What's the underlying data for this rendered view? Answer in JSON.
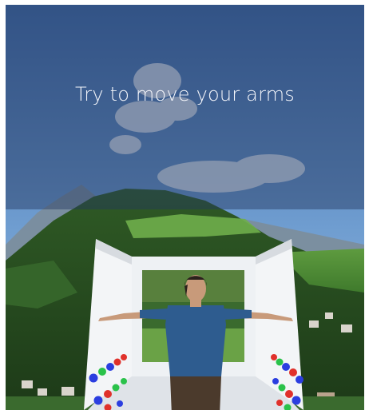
{
  "overlay": {
    "instruction": "Try to move your arms"
  },
  "scene": {
    "background": "mountain-landscape",
    "sky_color": "#4a77b0",
    "grass_color": "#4f8a3a",
    "overlay_color": "#23375f"
  },
  "chamber": {
    "wall_color": "#eef1f4",
    "indicator_colors": [
      "#e0312b",
      "#2ac24a",
      "#2b3ee0"
    ]
  },
  "avatar": {
    "shirt_color": "#2e5c8f",
    "pants_color": "#4b3a2c"
  }
}
